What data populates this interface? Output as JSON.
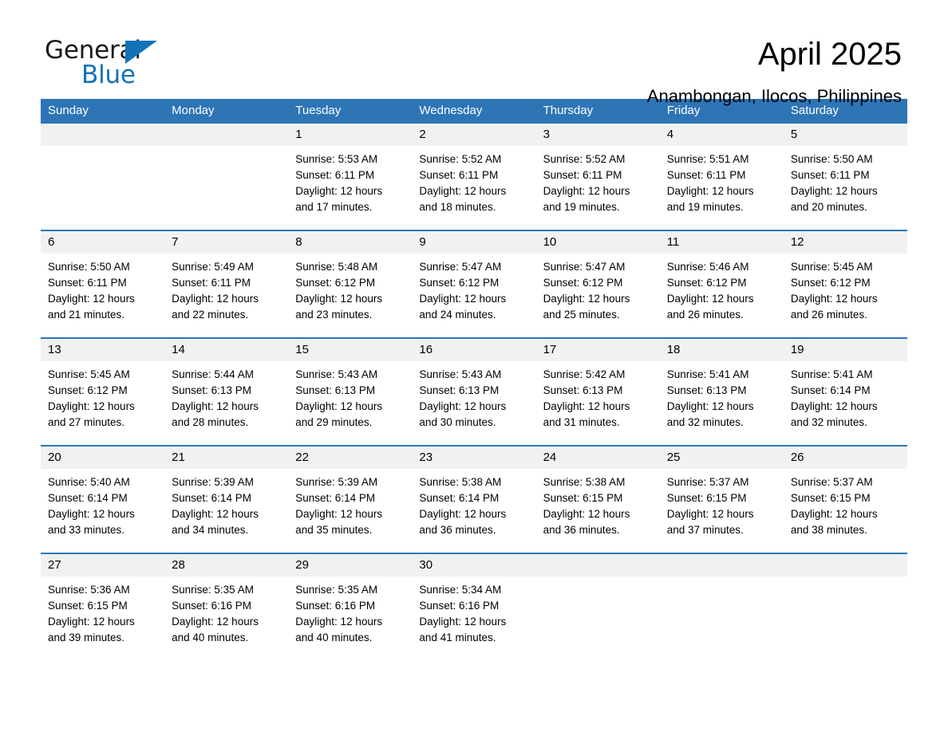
{
  "brand": {
    "line1": "General",
    "line2": "Blue",
    "triangle_color": "#1272b8"
  },
  "header": {
    "title": "April 2025",
    "location": "Anambongan, Ilocos, Philippines"
  },
  "theme": {
    "header_blue": "#2e75b6",
    "daynum_gray": "#f1f1f1"
  },
  "weekdays": [
    "Sunday",
    "Monday",
    "Tuesday",
    "Wednesday",
    "Thursday",
    "Friday",
    "Saturday"
  ],
  "weeks": [
    [
      {
        "day": "",
        "sunrise": "",
        "sunset": "",
        "daylight1": "",
        "daylight2": ""
      },
      {
        "day": "",
        "sunrise": "",
        "sunset": "",
        "daylight1": "",
        "daylight2": ""
      },
      {
        "day": "1",
        "sunrise": "Sunrise: 5:53 AM",
        "sunset": "Sunset: 6:11 PM",
        "daylight1": "Daylight: 12 hours",
        "daylight2": "and 17 minutes."
      },
      {
        "day": "2",
        "sunrise": "Sunrise: 5:52 AM",
        "sunset": "Sunset: 6:11 PM",
        "daylight1": "Daylight: 12 hours",
        "daylight2": "and 18 minutes."
      },
      {
        "day": "3",
        "sunrise": "Sunrise: 5:52 AM",
        "sunset": "Sunset: 6:11 PM",
        "daylight1": "Daylight: 12 hours",
        "daylight2": "and 19 minutes."
      },
      {
        "day": "4",
        "sunrise": "Sunrise: 5:51 AM",
        "sunset": "Sunset: 6:11 PM",
        "daylight1": "Daylight: 12 hours",
        "daylight2": "and 19 minutes."
      },
      {
        "day": "5",
        "sunrise": "Sunrise: 5:50 AM",
        "sunset": "Sunset: 6:11 PM",
        "daylight1": "Daylight: 12 hours",
        "daylight2": "and 20 minutes."
      }
    ],
    [
      {
        "day": "6",
        "sunrise": "Sunrise: 5:50 AM",
        "sunset": "Sunset: 6:11 PM",
        "daylight1": "Daylight: 12 hours",
        "daylight2": "and 21 minutes."
      },
      {
        "day": "7",
        "sunrise": "Sunrise: 5:49 AM",
        "sunset": "Sunset: 6:11 PM",
        "daylight1": "Daylight: 12 hours",
        "daylight2": "and 22 minutes."
      },
      {
        "day": "8",
        "sunrise": "Sunrise: 5:48 AM",
        "sunset": "Sunset: 6:12 PM",
        "daylight1": "Daylight: 12 hours",
        "daylight2": "and 23 minutes."
      },
      {
        "day": "9",
        "sunrise": "Sunrise: 5:47 AM",
        "sunset": "Sunset: 6:12 PM",
        "daylight1": "Daylight: 12 hours",
        "daylight2": "and 24 minutes."
      },
      {
        "day": "10",
        "sunrise": "Sunrise: 5:47 AM",
        "sunset": "Sunset: 6:12 PM",
        "daylight1": "Daylight: 12 hours",
        "daylight2": "and 25 minutes."
      },
      {
        "day": "11",
        "sunrise": "Sunrise: 5:46 AM",
        "sunset": "Sunset: 6:12 PM",
        "daylight1": "Daylight: 12 hours",
        "daylight2": "and 26 minutes."
      },
      {
        "day": "12",
        "sunrise": "Sunrise: 5:45 AM",
        "sunset": "Sunset: 6:12 PM",
        "daylight1": "Daylight: 12 hours",
        "daylight2": "and 26 minutes."
      }
    ],
    [
      {
        "day": "13",
        "sunrise": "Sunrise: 5:45 AM",
        "sunset": "Sunset: 6:12 PM",
        "daylight1": "Daylight: 12 hours",
        "daylight2": "and 27 minutes."
      },
      {
        "day": "14",
        "sunrise": "Sunrise: 5:44 AM",
        "sunset": "Sunset: 6:13 PM",
        "daylight1": "Daylight: 12 hours",
        "daylight2": "and 28 minutes."
      },
      {
        "day": "15",
        "sunrise": "Sunrise: 5:43 AM",
        "sunset": "Sunset: 6:13 PM",
        "daylight1": "Daylight: 12 hours",
        "daylight2": "and 29 minutes."
      },
      {
        "day": "16",
        "sunrise": "Sunrise: 5:43 AM",
        "sunset": "Sunset: 6:13 PM",
        "daylight1": "Daylight: 12 hours",
        "daylight2": "and 30 minutes."
      },
      {
        "day": "17",
        "sunrise": "Sunrise: 5:42 AM",
        "sunset": "Sunset: 6:13 PM",
        "daylight1": "Daylight: 12 hours",
        "daylight2": "and 31 minutes."
      },
      {
        "day": "18",
        "sunrise": "Sunrise: 5:41 AM",
        "sunset": "Sunset: 6:13 PM",
        "daylight1": "Daylight: 12 hours",
        "daylight2": "and 32 minutes."
      },
      {
        "day": "19",
        "sunrise": "Sunrise: 5:41 AM",
        "sunset": "Sunset: 6:14 PM",
        "daylight1": "Daylight: 12 hours",
        "daylight2": "and 32 minutes."
      }
    ],
    [
      {
        "day": "20",
        "sunrise": "Sunrise: 5:40 AM",
        "sunset": "Sunset: 6:14 PM",
        "daylight1": "Daylight: 12 hours",
        "daylight2": "and 33 minutes."
      },
      {
        "day": "21",
        "sunrise": "Sunrise: 5:39 AM",
        "sunset": "Sunset: 6:14 PM",
        "daylight1": "Daylight: 12 hours",
        "daylight2": "and 34 minutes."
      },
      {
        "day": "22",
        "sunrise": "Sunrise: 5:39 AM",
        "sunset": "Sunset: 6:14 PM",
        "daylight1": "Daylight: 12 hours",
        "daylight2": "and 35 minutes."
      },
      {
        "day": "23",
        "sunrise": "Sunrise: 5:38 AM",
        "sunset": "Sunset: 6:14 PM",
        "daylight1": "Daylight: 12 hours",
        "daylight2": "and 36 minutes."
      },
      {
        "day": "24",
        "sunrise": "Sunrise: 5:38 AM",
        "sunset": "Sunset: 6:15 PM",
        "daylight1": "Daylight: 12 hours",
        "daylight2": "and 36 minutes."
      },
      {
        "day": "25",
        "sunrise": "Sunrise: 5:37 AM",
        "sunset": "Sunset: 6:15 PM",
        "daylight1": "Daylight: 12 hours",
        "daylight2": "and 37 minutes."
      },
      {
        "day": "26",
        "sunrise": "Sunrise: 5:37 AM",
        "sunset": "Sunset: 6:15 PM",
        "daylight1": "Daylight: 12 hours",
        "daylight2": "and 38 minutes."
      }
    ],
    [
      {
        "day": "27",
        "sunrise": "Sunrise: 5:36 AM",
        "sunset": "Sunset: 6:15 PM",
        "daylight1": "Daylight: 12 hours",
        "daylight2": "and 39 minutes."
      },
      {
        "day": "28",
        "sunrise": "Sunrise: 5:35 AM",
        "sunset": "Sunset: 6:16 PM",
        "daylight1": "Daylight: 12 hours",
        "daylight2": "and 40 minutes."
      },
      {
        "day": "29",
        "sunrise": "Sunrise: 5:35 AM",
        "sunset": "Sunset: 6:16 PM",
        "daylight1": "Daylight: 12 hours",
        "daylight2": "and 40 minutes."
      },
      {
        "day": "30",
        "sunrise": "Sunrise: 5:34 AM",
        "sunset": "Sunset: 6:16 PM",
        "daylight1": "Daylight: 12 hours",
        "daylight2": "and 41 minutes."
      },
      {
        "day": "",
        "sunrise": "",
        "sunset": "",
        "daylight1": "",
        "daylight2": ""
      },
      {
        "day": "",
        "sunrise": "",
        "sunset": "",
        "daylight1": "",
        "daylight2": ""
      },
      {
        "day": "",
        "sunrise": "",
        "sunset": "",
        "daylight1": "",
        "daylight2": ""
      }
    ]
  ]
}
